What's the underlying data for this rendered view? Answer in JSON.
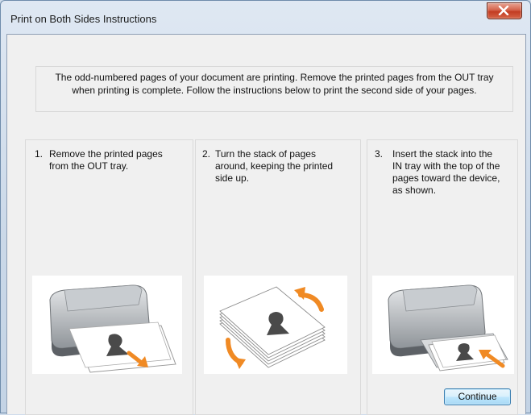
{
  "window": {
    "title": "Print on Both Sides Instructions",
    "close_icon": "close-icon"
  },
  "message": {
    "line1": "The odd-numbered pages of your document are printing.  Remove the printed pages from the OUT tray",
    "line2": "when printing is complete.  Follow the instructions below to print the second side of your pages."
  },
  "steps": [
    {
      "number": "1.",
      "lines": [
        "Remove the printed pages",
        "from the OUT tray."
      ],
      "illustration": "printer-out-tray-illustration"
    },
    {
      "number": "2.",
      "lines": [
        "Turn the stack of pages",
        "around, keeping the printed",
        "side up."
      ],
      "illustration": "rotate-stack-illustration"
    },
    {
      "number": "3.",
      "lines": [
        "Insert the stack into the",
        "IN tray with the top of the",
        "pages toward the device,",
        "as shown."
      ],
      "illustration": "printer-in-tray-illustration"
    }
  ],
  "buttons": {
    "continue_label": "Continue"
  },
  "colors": {
    "accent_arrow": "#f08a24",
    "close_button": "#c7432a",
    "button_border": "#3c7fb1"
  }
}
